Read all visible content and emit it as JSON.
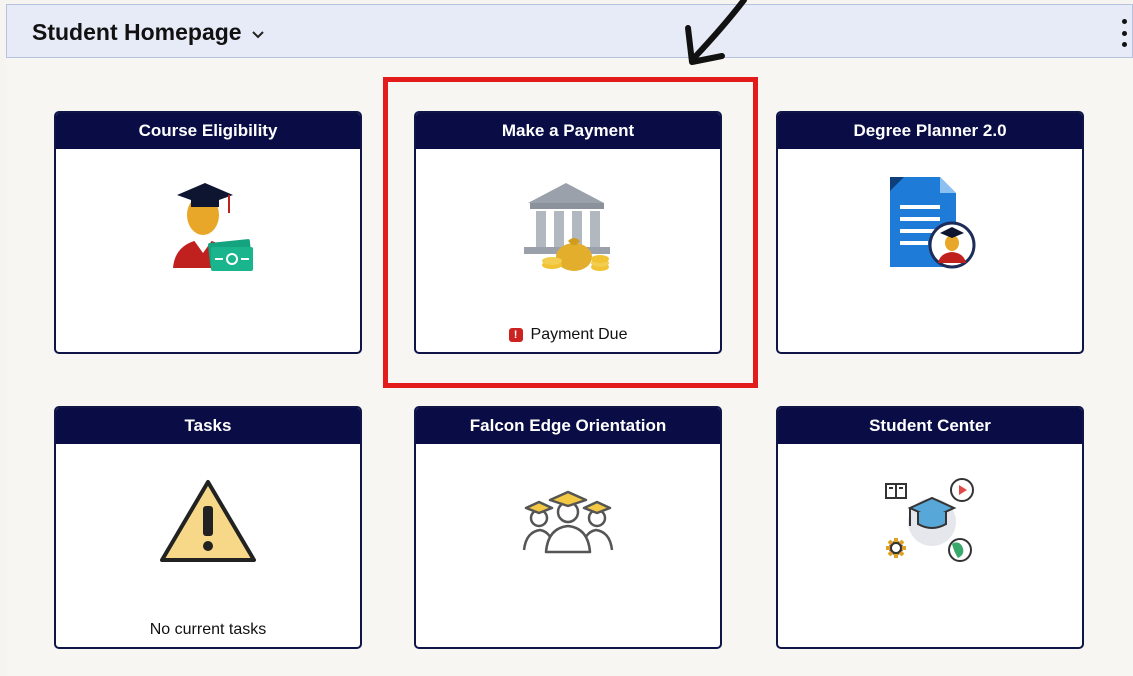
{
  "header": {
    "title": "Student Homepage",
    "title_icon": "chevron-down-icon",
    "menu_icon": "kebab-menu-icon"
  },
  "tiles": [
    {
      "title": "Course Eligibility",
      "icon": "graduate-with-cash-icon",
      "footer": ""
    },
    {
      "title": "Make a Payment",
      "icon": "bank-with-money-bag-icon",
      "footer": "Payment Due",
      "footer_icon": "alert-icon",
      "footer_icon_glyph": "!"
    },
    {
      "title": "Degree Planner 2.0",
      "icon": "document-with-graduate-icon",
      "footer": ""
    },
    {
      "title": "Tasks",
      "icon": "warning-triangle-icon",
      "footer": "No current tasks"
    },
    {
      "title": "Falcon Edge Orientation",
      "icon": "graduates-group-icon",
      "footer": ""
    },
    {
      "title": "Student Center",
      "icon": "student-center-icon",
      "footer": ""
    }
  ],
  "annotation": {
    "highlight_color": "#e31b1b",
    "arrow_icon": "pointing-arrow-icon"
  },
  "colors": {
    "tile_header": "#0a0d45",
    "header_bar": "#e6ebf7",
    "alert": "#cc2222"
  }
}
